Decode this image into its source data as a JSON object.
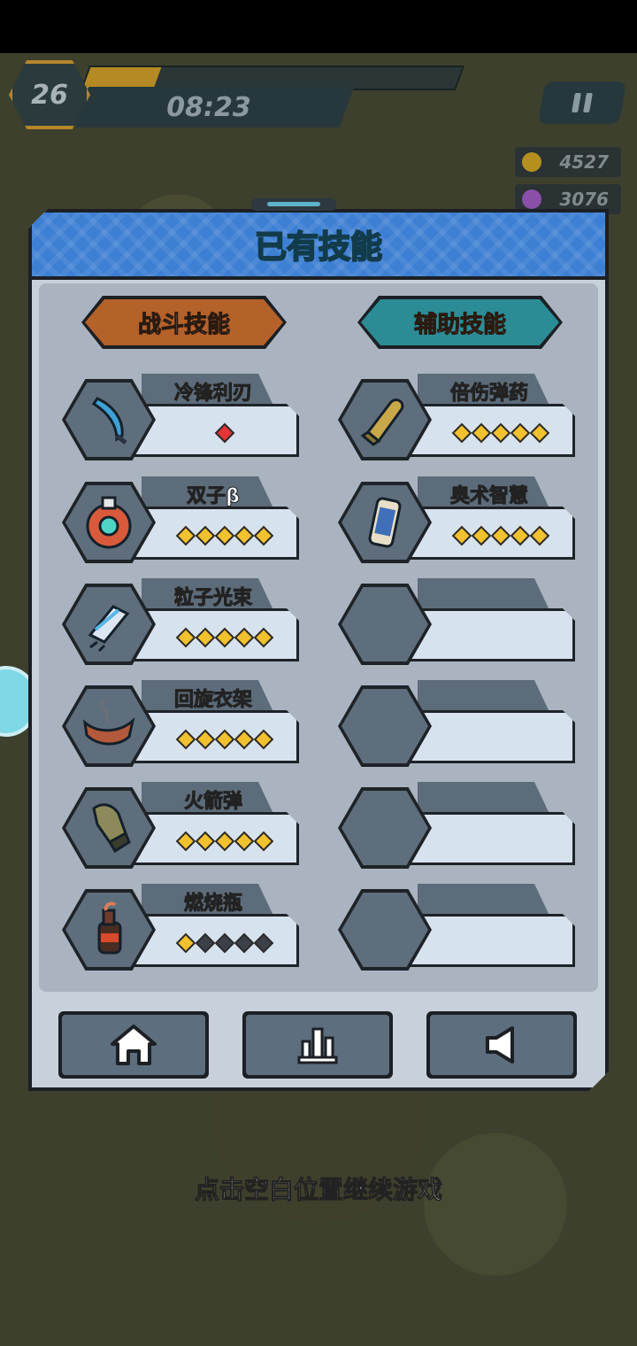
{
  "hud": {
    "level": "26",
    "timer": "08:23",
    "xp_fraction": 0.19,
    "gold": "4527",
    "gems": "3076"
  },
  "panel": {
    "title": "已有技能",
    "combat_label": "战斗技能",
    "support_label": "辅助技能"
  },
  "combat_skills": [
    {
      "name": "冷锋利刃",
      "icon": "blade-icon",
      "level": 1,
      "special": "red-diamond"
    },
    {
      "name": "双子β",
      "icon": "twin-drone-icon",
      "level": 5
    },
    {
      "name": "粒子光束",
      "icon": "particle-beam-icon",
      "level": 5
    },
    {
      "name": "回旋衣架",
      "icon": "boomerang-hanger-icon",
      "level": 5
    },
    {
      "name": "火箭弹",
      "icon": "rocket-icon",
      "level": 5
    },
    {
      "name": "燃烧瓶",
      "icon": "molotov-icon",
      "level": 1
    }
  ],
  "support_skills": [
    {
      "name": "倍伤弹药",
      "icon": "bullet-icon",
      "level": 5
    },
    {
      "name": "奥术智慧",
      "icon": "arcane-scroll-icon",
      "level": 5
    },
    {
      "name": "",
      "icon": "",
      "level": 0
    },
    {
      "name": "",
      "icon": "",
      "level": 0
    },
    {
      "name": "",
      "icon": "",
      "level": 0
    },
    {
      "name": "",
      "icon": "",
      "level": 0
    }
  ],
  "buttons": [
    "home-icon",
    "stats-icon",
    "sound-icon"
  ],
  "hint": "点击空白位置继续游戏",
  "colors": {
    "panel_header": "#3c7fd3",
    "combat_badge": "#b4612a",
    "support_badge": "#2c8c95",
    "star_on": "#f2c12e",
    "star_off": "#3b4049"
  }
}
